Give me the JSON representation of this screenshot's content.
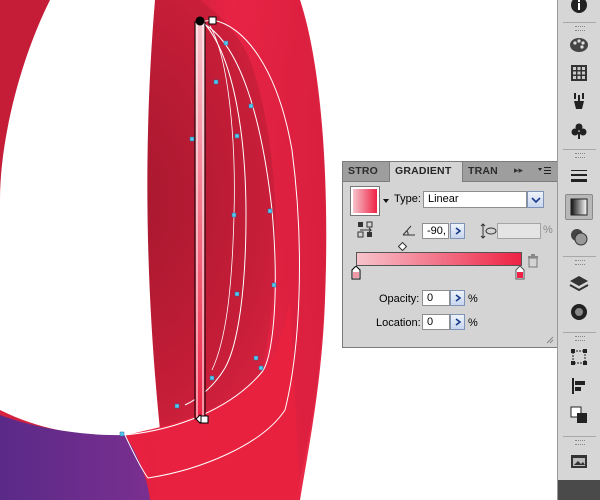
{
  "panel": {
    "tabs": [
      {
        "label": "STRO"
      },
      {
        "label": "GRADIENT"
      },
      {
        "label": "TRAN"
      }
    ],
    "type_label": "Type:",
    "type_value": "Linear",
    "angle_value": "-90,",
    "aspect_value": "",
    "aspect_unit": "%",
    "opacity_label": "Opacity:",
    "opacity_value": "0",
    "opacity_unit": "%",
    "location_label": "Location:",
    "location_value": "0",
    "location_unit": "%"
  },
  "colors": {
    "gradient_start": "#f7c4cc",
    "gradient_end": "#ee2244",
    "ribbon_main": "#e4243f",
    "ribbon_dark": "#b01a35",
    "ribbon_purple": "#6a2c8c",
    "callout_arrow": "#e01010",
    "path_outline": "#ffffff",
    "anchor_point": "#55c8f0"
  },
  "dock": {
    "icons": [
      "info-icon",
      "color-palette-icon",
      "swatches-icon",
      "brushes-icon",
      "symbols-icon",
      "stroke-icon",
      "gradient-icon",
      "transparency-icon",
      "layers-icon",
      "appearance-icon",
      "align-icon",
      "pathfinder-icon",
      "transform-icon",
      "links-icon"
    ]
  }
}
